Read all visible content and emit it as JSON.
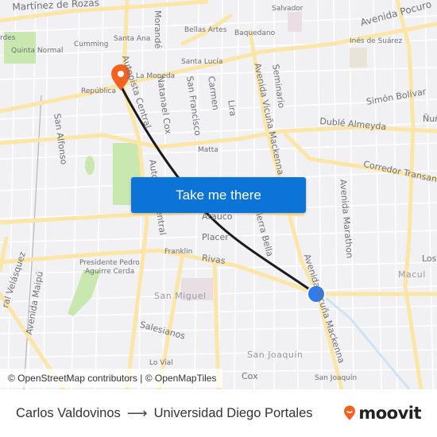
{
  "map": {
    "labels": {
      "martinez_de_rozas": "Martínez de Rozas",
      "salvador": "Salvador",
      "avenida_pocuro": "Avenida Pocuro",
      "verdes": "rdes",
      "morande": "Morandé",
      "bellas_artes": "Bellas Artes",
      "baquedano": "Baquedano",
      "ines_de_suarez": "Inés de Suárez",
      "quinta_normal": "Quinta Normal",
      "cumming": "Cumming",
      "santa_ana": "Santa Ana",
      "santa_lucia": "Santa Lucía",
      "la_moneda": "La Moneda",
      "republica": "República",
      "autopista_central_1": "Autopista Central",
      "natanael_cox": "Natanael Cox",
      "san_francisco": "San Francisco",
      "carmen": "Carmen",
      "lira": "Lira",
      "avenida_vicuna_mackenna": "Avenida Vicuña Mackenna",
      "seminario": "Seminario",
      "simon_bolivar": "Simón Bolívar",
      "nunoa": "Ñuñ",
      "duble_almeyda": "Dublé Almeyda",
      "san_alfonso": "San Alfonso",
      "matta": "Matta",
      "corredor_transantiago": "Corredor Transant",
      "avenida_marathon": "Avenida Marathon",
      "arauco": "Arauco",
      "sierra_bella": "Sierra Bella",
      "placer": "Placer",
      "autopista_central_2": "Autopista Central",
      "franklin": "Franklin",
      "rivas": "Rivas",
      "los": "Los",
      "macul": "Macul",
      "avenida_vicuna_mackenna_2": "Avenida Vicuña Mackenna",
      "presidente_pedro": "Presidente Pedro",
      "aguirre_cerda": "Aguirre Cerda",
      "san_miguel": "San Miguel",
      "velasquez": "ral Velásquez",
      "avenida_maipu": "Avenida Maipú",
      "salesianos": "Salesianos",
      "lo_vial": "Lo Vial",
      "san_joaquin_area": "San Joaquín",
      "san_joaquin_station": "San Joaquín",
      "cox": "Cox"
    },
    "origin_marker": "origin-pin",
    "destination_marker": "destination-dot",
    "colors": {
      "route": "#1a1a1a",
      "origin_pin": "#f5621f",
      "destination_dot": "#2f7bef",
      "road_major": "#fbe6a8",
      "park": "#c9e8b0"
    }
  },
  "cta": {
    "label": "Take me there"
  },
  "attribution": {
    "text": "© OpenStreetMap contributors | © OpenMapTiles"
  },
  "footer": {
    "origin": "Carlos Valdovinos",
    "arrow": "⟶",
    "destination": "Universidad Diego Portales",
    "logo_text": "moovit",
    "logo_color": "#f5621f"
  }
}
